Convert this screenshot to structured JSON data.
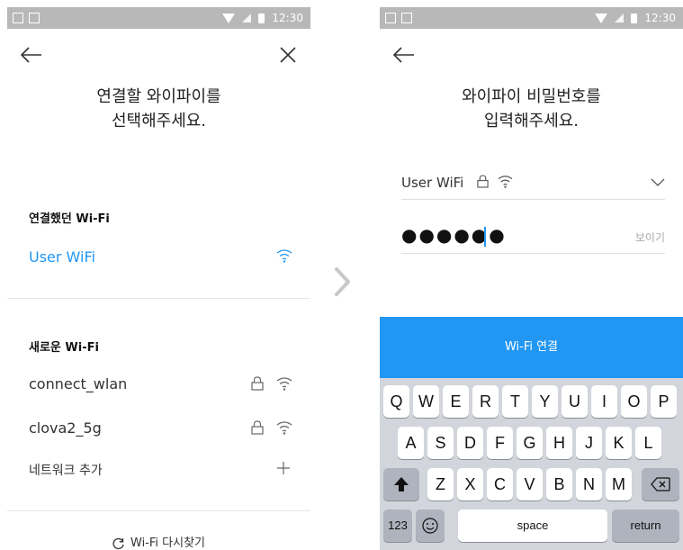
{
  "status_bar": {
    "time": "12:30"
  },
  "left_screen": {
    "title_line1": "연결할 와이파이를",
    "title_line2": "선택해주세요.",
    "recent_section": {
      "title": "연결했던 Wi-Fi",
      "network": "User WiFi"
    },
    "new_section": {
      "title": "새로운 Wi-Fi",
      "networks": [
        {
          "name": "connect_wlan",
          "locked": true
        },
        {
          "name": "clova2_5g",
          "locked": true
        }
      ],
      "add_network": "네트워크 추가"
    },
    "refresh_label": "Wi-Fi 다시찾기"
  },
  "right_screen": {
    "title_line1": "와이파이 비밀번호를",
    "title_line2": "입력해주세요.",
    "selected_network": "User WiFi",
    "password_mask": "●●●●●●",
    "show_label": "보이기",
    "connect_button": "Wi-Fi 연결"
  },
  "keyboard": {
    "row1": [
      "Q",
      "W",
      "E",
      "R",
      "T",
      "Y",
      "U",
      "I",
      "O",
      "P"
    ],
    "row2": [
      "A",
      "S",
      "D",
      "F",
      "G",
      "H",
      "J",
      "K",
      "L"
    ],
    "row3": [
      "Z",
      "X",
      "C",
      "V",
      "B",
      "N",
      "M"
    ],
    "numbers_key": "123",
    "space_key": "space",
    "return_key": "return"
  },
  "colors": {
    "accent": "#2196f3",
    "status_bar": "#b8b8b8",
    "keyboard_bg": "#d2d5db"
  }
}
